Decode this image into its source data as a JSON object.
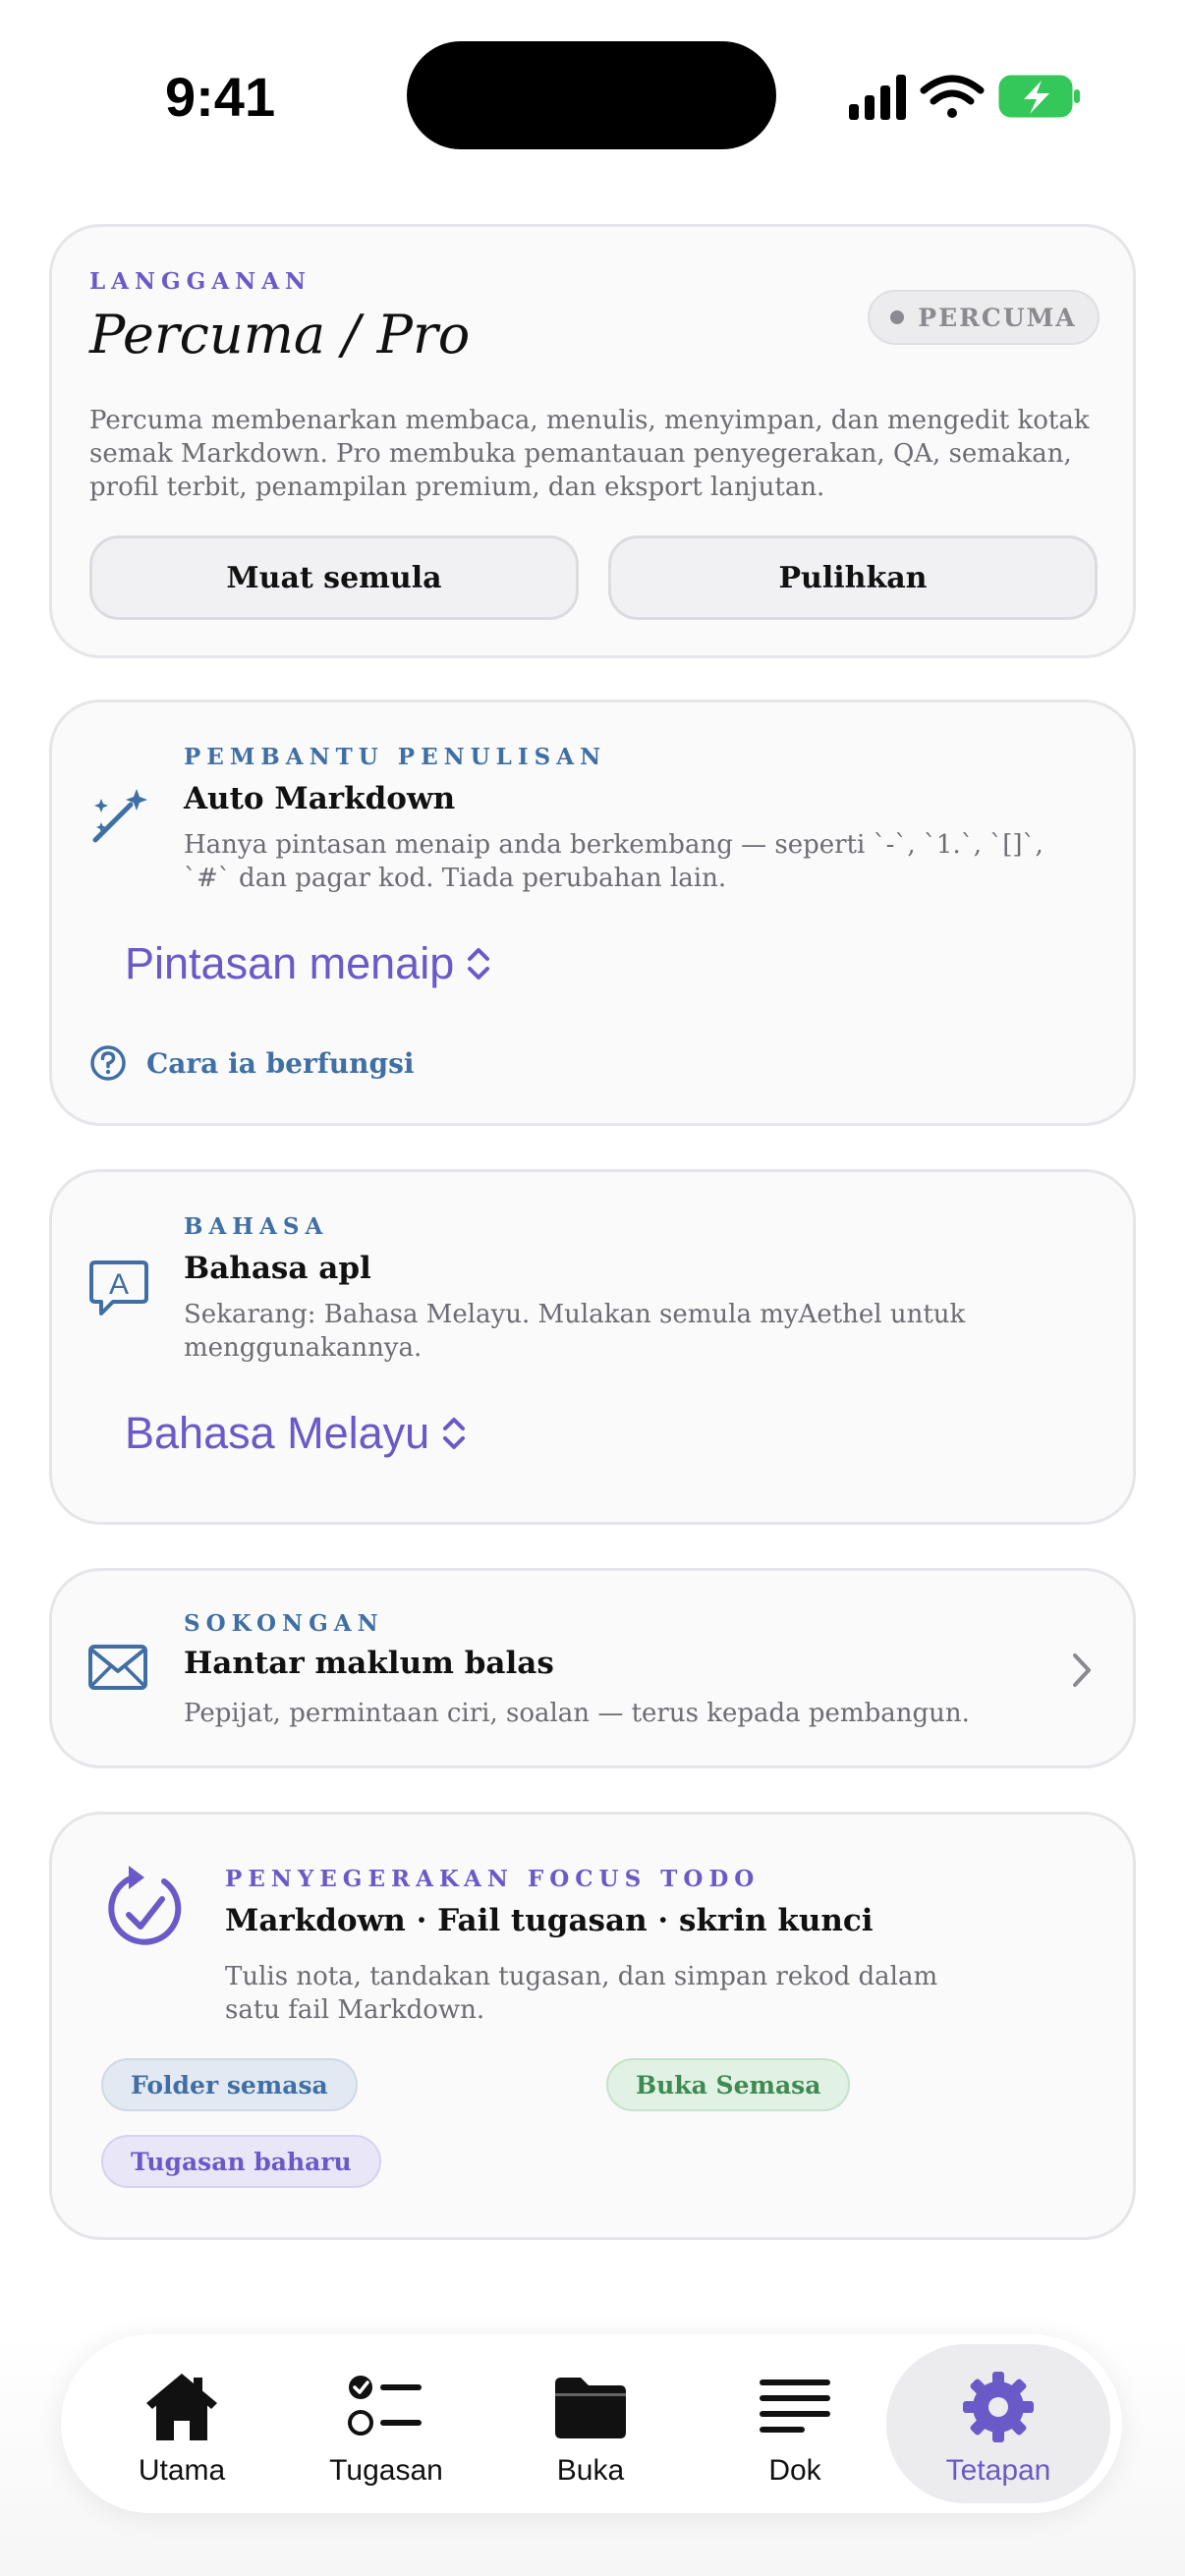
{
  "status_bar": {
    "time": "9:41"
  },
  "subscription": {
    "eyebrow": "LANGGANAN",
    "title": "Percuma / Pro",
    "badge": "PERCUMA",
    "description": "Percuma membenarkan membaca, menulis, menyimpan, dan mengedit kotak semak Markdown. Pro membuka pemantauan penyegerakan, QA, semakan, profil terbit, penampilan premium, dan eksport lanjutan.",
    "reload_label": "Muat semula",
    "restore_label": "Pulihkan"
  },
  "writing_assistant": {
    "eyebrow": "PEMBANTU PENULISAN",
    "title": "Auto Markdown",
    "description": "Hanya pintasan menaip anda berkembang — seperti `-`, `1.`, `[]`, `#` dan pagar kod. Tiada perubahan lain.",
    "picker_value": "Pintasan menaip",
    "help_link": "Cara ia berfungsi",
    "icon": "magic-wand-icon"
  },
  "language": {
    "eyebrow": "BAHASA",
    "title": "Bahasa apl",
    "description": "Sekarang: Bahasa Melayu. Mulakan semula myAethel untuk menggunakannya.",
    "picker_value": "Bahasa Melayu",
    "icon": "language-bubble-icon"
  },
  "support": {
    "eyebrow": "SOKONGAN",
    "title": "Hantar maklum balas",
    "description": "Pepijat, permintaan ciri, soalan — terus kepada pembangun.",
    "icon": "envelope-icon"
  },
  "focus_sync": {
    "eyebrow": "PENYEGERAKAN FOCUS TODO",
    "title": "Markdown · Fail tugasan · skrin kunci",
    "description": "Tulis nota, tandakan tugasan, dan simpan rekod dalam satu fail Markdown.",
    "chips": {
      "folder": "Folder semasa",
      "open": "Buka Semasa",
      "task": "Tugasan baharu"
    },
    "icon": "sync-check-icon"
  },
  "tabs": [
    {
      "label": "Utama",
      "icon": "house-icon"
    },
    {
      "label": "Tugasan",
      "icon": "checklist-icon"
    },
    {
      "label": "Buka",
      "icon": "folder-icon"
    },
    {
      "label": "Dok",
      "icon": "text-lines-icon"
    },
    {
      "label": "Tetapan",
      "icon": "gear-icon"
    }
  ],
  "colors": {
    "accent_purple": "#6a5ac8",
    "accent_blue": "#3f6fa5",
    "accent_green": "#3f8a52",
    "battery_green": "#34c759"
  }
}
